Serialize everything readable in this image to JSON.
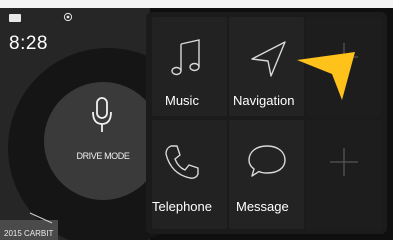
{
  "status": {
    "time": "8:28",
    "battery_icon": "battery-icon",
    "gps_icon": "gps-icon"
  },
  "drive_mode": {
    "label": "DRIVE MODE",
    "icon": "microphone-icon"
  },
  "apps": [
    {
      "label": "Music",
      "icon": "music-note-icon"
    },
    {
      "label": "Navigation",
      "icon": "navigation-arrow-icon"
    },
    {
      "label": "",
      "icon": "add-icon"
    },
    {
      "label": "Telephone",
      "icon": "phone-icon"
    },
    {
      "label": "Message",
      "icon": "message-bubble-icon"
    },
    {
      "label": "",
      "icon": "add-icon"
    }
  ],
  "watermark": {
    "text": "2015 CARBIT"
  },
  "colors": {
    "accent_cursor": "#ffc21a",
    "background": "#0f0f0f",
    "tile_bg": "#1f1f1f",
    "text": "#ffffff"
  }
}
